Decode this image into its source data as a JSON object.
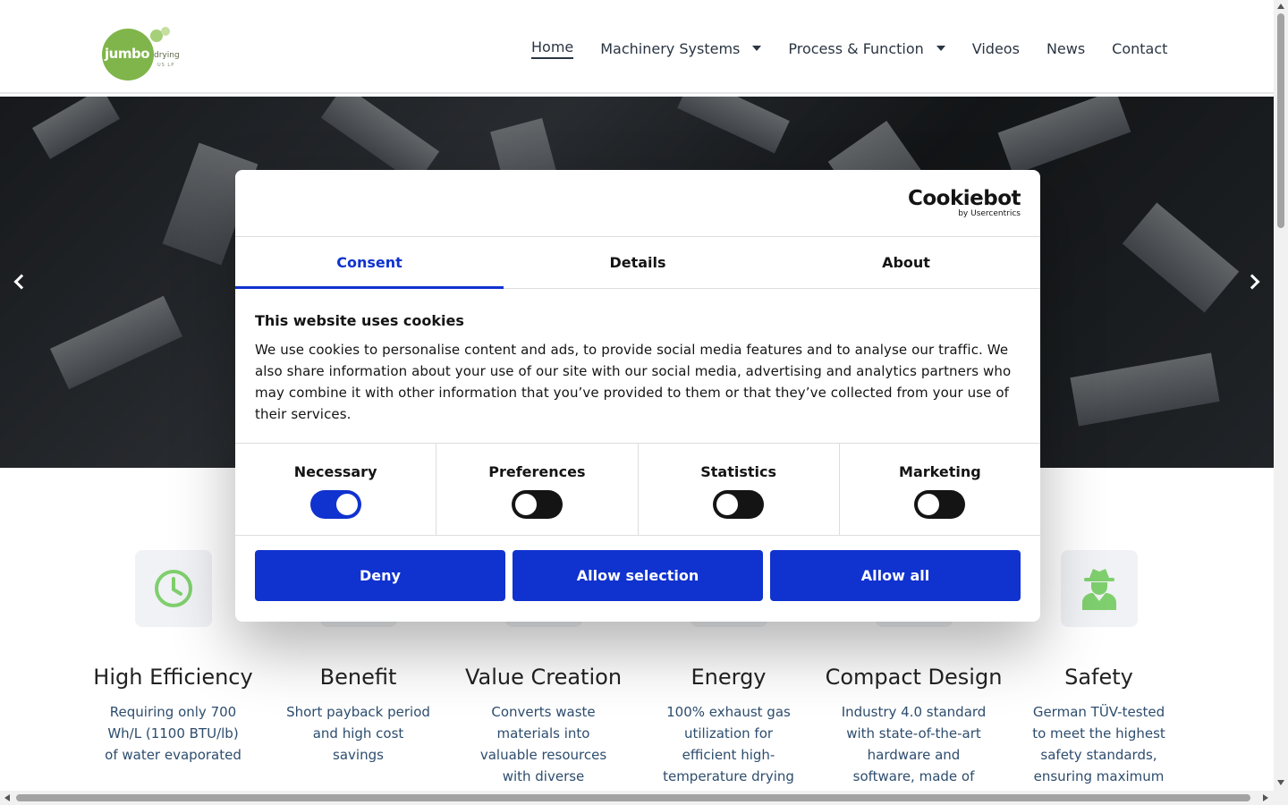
{
  "logo": {
    "word_main": "jumbo",
    "word_side": "drying",
    "word_small": "US LP"
  },
  "nav": {
    "items": [
      {
        "label": "Home"
      },
      {
        "label": "Machinery Systems"
      },
      {
        "label": "Process & Function"
      },
      {
        "label": "Videos"
      },
      {
        "label": "News"
      },
      {
        "label": "Contact"
      }
    ]
  },
  "features": [
    {
      "title": "High Efficiency",
      "text": "Requiring only 700 Wh/L (1100 BTU/lb) of water evaporated",
      "icon": "clock-icon"
    },
    {
      "title": "Benefit",
      "text": "Short payback period and high cost savings",
      "icon": "coins-icon"
    },
    {
      "title": "Value Creation",
      "text": "Converts waste materials into valuable resources with diverse",
      "icon": "recycle-icon"
    },
    {
      "title": "Energy",
      "text": "100% exhaust gas utilization for efficient high-temperature drying",
      "icon": "flame-icon"
    },
    {
      "title": "Compact Design",
      "text": "Industry 4.0 standard with state-of-the-art hardware and software, made of",
      "icon": "cube-icon"
    },
    {
      "title": "Safety",
      "text": "German TÜV-tested to meet the highest safety standards, ensuring maximum protection & ATEX-",
      "icon": "agent-icon"
    }
  ],
  "cookie": {
    "brand": "Cookiebot",
    "brand_sub": "by Usercentrics",
    "tabs": [
      "Consent",
      "Details",
      "About"
    ],
    "heading": "This website uses cookies",
    "body": "We use cookies to personalise content and ads, to provide social media features and to analyse our traffic. We also share information about your use of our site with our social media, advertising and analytics partners who may combine it with other information that you’ve provided to them or that they’ve collected from your use of their services.",
    "toggles": [
      {
        "label": "Necessary",
        "on": true
      },
      {
        "label": "Preferences",
        "on": false
      },
      {
        "label": "Statistics",
        "on": false
      },
      {
        "label": "Marketing",
        "on": false
      }
    ],
    "buttons": {
      "deny": "Deny",
      "allow_selection": "Allow selection",
      "allow_all": "Allow all"
    },
    "accent": "#1032cf"
  },
  "colors": {
    "brand_green": "#7fb54a",
    "icon_green": "#7fcf6e"
  }
}
